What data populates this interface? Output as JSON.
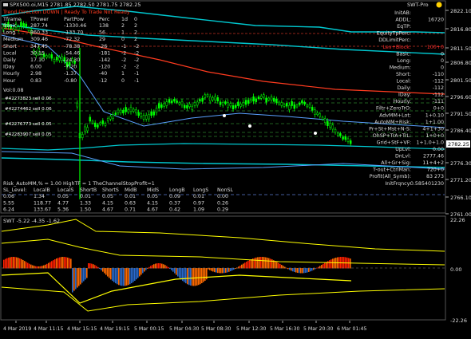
{
  "window": {
    "symbol_header": "SPX500.oi,M15  2781.85 2782.50 2781.75 2782.25",
    "ea_name": "SWT-Pro",
    "ea_icon": "smiley-icon"
  },
  "trend_line": "Trend Direction  DOWN  |  Ready To Trade  Not Ready",
  "tf_table": {
    "headers": [
      "Tframe",
      "TPower",
      "PartPow",
      "Perc",
      "1d",
      "0"
    ],
    "rows": [
      [
        "Basic",
        "287.74",
        "-1330.46",
        "138",
        "2",
        "2"
      ],
      [
        "Long",
        "860.33",
        "-133.70",
        "56",
        "1",
        "2"
      ],
      [
        "Medium",
        "309.46",
        "-72.32",
        "29",
        "0",
        "2"
      ],
      [
        "Short",
        "347.45",
        "-78.38",
        "-26",
        "-1",
        "-2"
      ],
      [
        "Local",
        "30.15",
        "-54.46",
        "-181",
        "-2",
        "-2"
      ],
      [
        "Daily",
        "17.10",
        "-24.30",
        "-142",
        "-2",
        "-2"
      ],
      [
        "IDay",
        "6.00",
        "-7.20",
        "-120",
        "-2",
        "-2"
      ],
      [
        "Hourly",
        "2.98",
        "-1.37",
        "-40",
        "1",
        "-1"
      ],
      [
        "Hour",
        "0.83",
        "-0.80",
        "-12",
        "0",
        "-1"
      ]
    ],
    "extra": "Vol:0.08"
  },
  "order_lines": [
    "#42273823 sell 0.06",
    "#42274462 sell 0.06",
    "#42276773 sell 0.05",
    "#42283907 sell 0.05"
  ],
  "right_panel": [
    {
      "label": "InitAB:",
      "value": ""
    },
    {
      "label": "ADDL:",
      "value": "16720"
    },
    {
      "label": "EqTP:",
      "value": ""
    },
    {
      "label": "EquityTpPerc:",
      "value": ""
    },
    {
      "label": "DDLimitPerc:",
      "value": ""
    },
    {
      "label": "Lev+Block:",
      "value": "100+0",
      "red": true
    },
    {
      "label": "Basic:",
      "value": "0"
    },
    {
      "label": "Long:",
      "value": "0"
    },
    {
      "label": "Medium:",
      "value": "0"
    },
    {
      "label": "Short:",
      "value": "-110"
    },
    {
      "label": "Local:",
      "value": "-112"
    },
    {
      "label": "Daily:",
      "value": "-112"
    },
    {
      "label": "IDay:",
      "value": "-112"
    },
    {
      "label": "Hourly:",
      "value": "-111"
    },
    {
      "label": "Filtr+ZeroTrO:",
      "value": "0+0"
    },
    {
      "label": "AdvMM+Lot:",
      "value": "1+0.10"
    },
    {
      "label": "AutoMM+Risk:",
      "value": "1+1.00"
    },
    {
      "label": "Pr+St+Mst+N-S:",
      "value": "4+1+30"
    },
    {
      "label": "OhSP+TrA+TrL:",
      "value": "1+0+0"
    },
    {
      "label": "Grid+StF+VF:",
      "value": "1+1.0+1.0"
    },
    {
      "label": "UpLvl:",
      "value": "0.00"
    },
    {
      "label": "DnLvl:",
      "value": "2777.46"
    },
    {
      "label": "All+Gr+Sig:",
      "value": "11+4+2"
    },
    {
      "label": "T-out+CtrlMan:",
      "value": "720+0"
    },
    {
      "label": "Profit(All_Symb):",
      "value": "83  273"
    },
    {
      "label": "InitFrqncy:",
      "value": "0.585401230"
    }
  ],
  "risk_block": {
    "line1": "Risk_AutoMM,% = 1.00     HighTF = 1     TheChannelStopProfit=1",
    "headers": [
      "SL_Level:",
      "LocalB",
      "LocalS",
      "ShortB",
      "ShortS",
      "MidB",
      "MidS",
      "LongB",
      "LongS",
      "NonSL"
    ],
    "rows": [
      [
        "0.06",
        "1.34",
        "0.05",
        "0.01",
        "0.05",
        "0.01",
        "0.05",
        "0.09",
        "0.01",
        "0.00"
      ],
      [
        "5.55",
        "118.77",
        "4.77",
        "1.33",
        "4.15",
        "0.63",
        "4.15",
        "0.37",
        "0.97",
        "0.26"
      ],
      [
        "6.24",
        "133.67",
        "5.36",
        "1.50",
        "4.67",
        "0.71",
        "4.67",
        "0.42",
        "1.09",
        "0.29"
      ]
    ]
  },
  "price_axis": {
    "ticks": [
      "2822.10",
      "2816.80",
      "2811.50",
      "2806.80",
      "2801.50",
      "2796.60",
      "2791.50",
      "2786.40",
      "2776.30",
      "2771.20",
      "2766.10",
      "2761.00"
    ],
    "current": "2782.25"
  },
  "indicator": {
    "label": "SWT -5.22 -4.35 -1.62",
    "ticks": [
      "22.26",
      "0.00",
      "-22.26"
    ]
  },
  "time_axis": [
    "4 Mar 2019",
    "4 Mar 11:15",
    "4 Mar 15:15",
    "4 Mar 19:15",
    "5 Mar 00:15",
    "5 Mar 04:30",
    "5 Mar 08:30",
    "5 Mar 12:30",
    "5 Mar 16:30",
    "5 Mar 20:30",
    "6 Mar 01:45"
  ],
  "colors": {
    "price_line": "#00c8d0",
    "candle": "#00ff00",
    "ma_red": "#ff3b1f",
    "ma_blue": "#5aa0ff",
    "yellow": "#ffff00",
    "grid_green": "#2a7f2a"
  }
}
